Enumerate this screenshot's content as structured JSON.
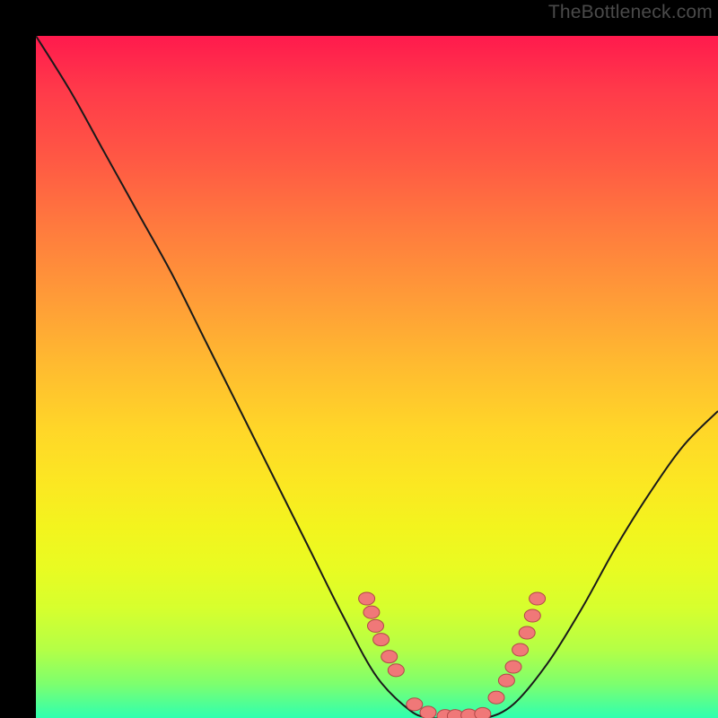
{
  "watermark": "TheBottleneck.com",
  "chart_data": {
    "type": "line",
    "title": "",
    "xlabel": "",
    "ylabel": "",
    "x": [
      0.0,
      0.05,
      0.1,
      0.15,
      0.2,
      0.25,
      0.3,
      0.35,
      0.4,
      0.45,
      0.5,
      0.55,
      0.58,
      0.6,
      0.63,
      0.66,
      0.7,
      0.75,
      0.8,
      0.85,
      0.9,
      0.95,
      1.0
    ],
    "values": [
      1.0,
      0.92,
      0.83,
      0.74,
      0.65,
      0.55,
      0.45,
      0.35,
      0.25,
      0.15,
      0.06,
      0.01,
      0.0,
      0.0,
      0.0,
      0.0,
      0.02,
      0.08,
      0.16,
      0.25,
      0.33,
      0.4,
      0.45
    ],
    "ylim": [
      0,
      1
    ],
    "xlim": [
      0,
      1
    ],
    "gradient_colors_top_to_bottom": [
      "#ff1a4d",
      "#ff7a3e",
      "#ffd728",
      "#f3f41e",
      "#7dff6e",
      "#2fffb0"
    ],
    "marker_clusters": [
      {
        "side": "left",
        "x_range": [
          0.48,
          0.55
        ],
        "y_range": [
          0.03,
          0.18
        ]
      },
      {
        "side": "bottom",
        "x_range": [
          0.55,
          0.66
        ],
        "y_range": [
          0.0,
          0.02
        ]
      },
      {
        "side": "right",
        "x_range": [
          0.67,
          0.74
        ],
        "y_range": [
          0.02,
          0.18
        ]
      }
    ],
    "markers": [
      {
        "x": 0.485,
        "y": 0.175
      },
      {
        "x": 0.492,
        "y": 0.155
      },
      {
        "x": 0.498,
        "y": 0.135
      },
      {
        "x": 0.506,
        "y": 0.115
      },
      {
        "x": 0.518,
        "y": 0.09
      },
      {
        "x": 0.528,
        "y": 0.07
      },
      {
        "x": 0.555,
        "y": 0.02
      },
      {
        "x": 0.575,
        "y": 0.008
      },
      {
        "x": 0.6,
        "y": 0.003
      },
      {
        "x": 0.615,
        "y": 0.003
      },
      {
        "x": 0.635,
        "y": 0.004
      },
      {
        "x": 0.655,
        "y": 0.006
      },
      {
        "x": 0.675,
        "y": 0.03
      },
      {
        "x": 0.69,
        "y": 0.055
      },
      {
        "x": 0.7,
        "y": 0.075
      },
      {
        "x": 0.71,
        "y": 0.1
      },
      {
        "x": 0.72,
        "y": 0.125
      },
      {
        "x": 0.728,
        "y": 0.15
      },
      {
        "x": 0.735,
        "y": 0.175
      }
    ]
  }
}
